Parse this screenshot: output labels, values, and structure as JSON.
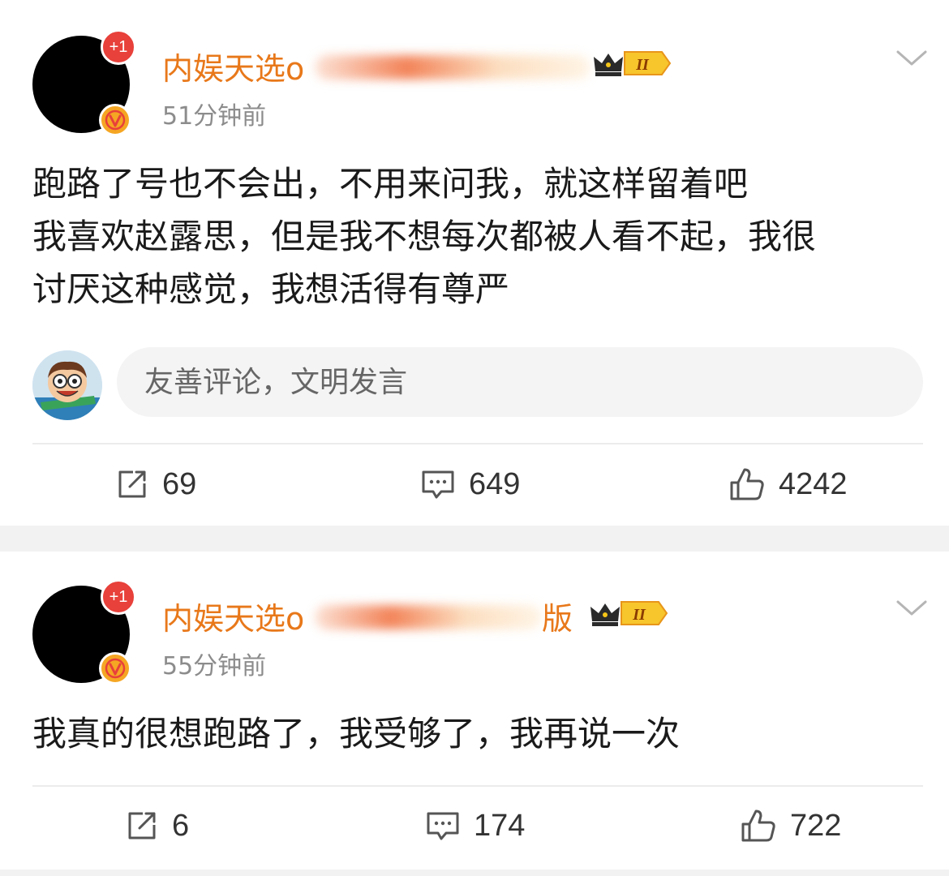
{
  "posts": [
    {
      "notif_badge": "+1",
      "username_prefix": "内娱天选",
      "username_tail": "o",
      "level_badge": "II",
      "time": "51分钟前",
      "content_lines": [
        "跑路了号也不会出，不用来问我，就这样留着吧",
        "我喜欢赵露思，但是我不想每次都被人看不起，我很",
        "讨厌这种感觉，我想活得有尊严"
      ],
      "comment_placeholder": "友善评论，文明发言",
      "reposts": "69",
      "comments": "649",
      "likes": "4242"
    },
    {
      "notif_badge": "+1",
      "username_prefix": "内娱天选",
      "username_tail": "o",
      "username_end": "版",
      "level_badge": "II",
      "time": "55分钟前",
      "content_lines": [
        "我真的很想跑路了，我受够了，我再说一次"
      ],
      "reposts": "6",
      "comments": "174",
      "likes": "722"
    }
  ],
  "colors": {
    "username": "#e8781a",
    "notif_badge": "#e8403a",
    "verify_badge": "#f5a623",
    "time": "#8c8c8c",
    "text": "#1a1a1a"
  },
  "icons": {
    "repost": "repost-icon",
    "comment": "comment-icon",
    "like": "like-icon",
    "chevron": "chevron-down-icon",
    "crown": "crown-icon",
    "verify": "verified-v-icon"
  }
}
